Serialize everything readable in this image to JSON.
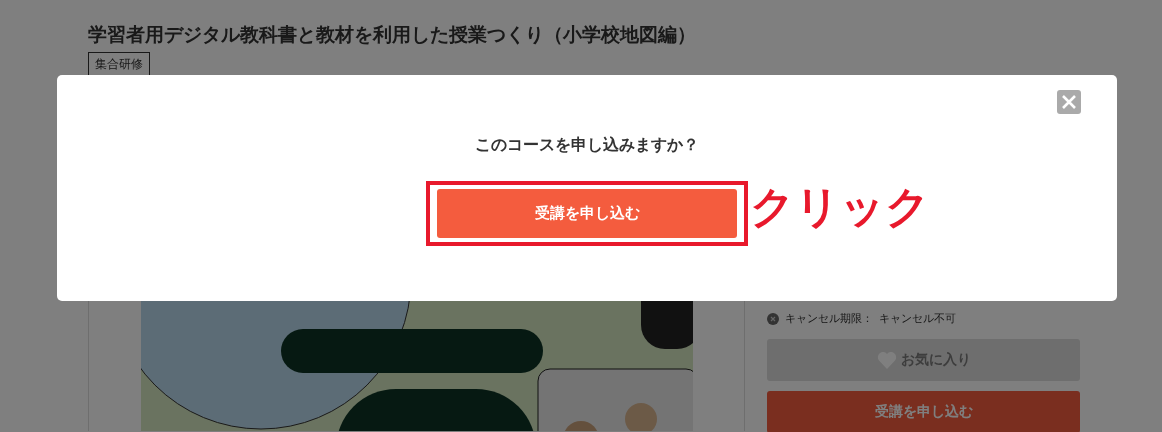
{
  "page": {
    "title": "学習者用デジタル教科書と教材を利用した授業つくり（小学校地図編）",
    "tag": "集合研修",
    "cancel_deadline": {
      "label": "キャンセル期限：",
      "value": "キャンセル不可"
    },
    "favorite_button": {
      "label": "お気に入り",
      "disabled": true
    },
    "apply_button": {
      "label": "受講を申し込む"
    }
  },
  "modal": {
    "question": "このコースを申し込みますか？",
    "confirm_button": "受講を申し込む",
    "annotation": {
      "label": "クリック"
    }
  }
}
